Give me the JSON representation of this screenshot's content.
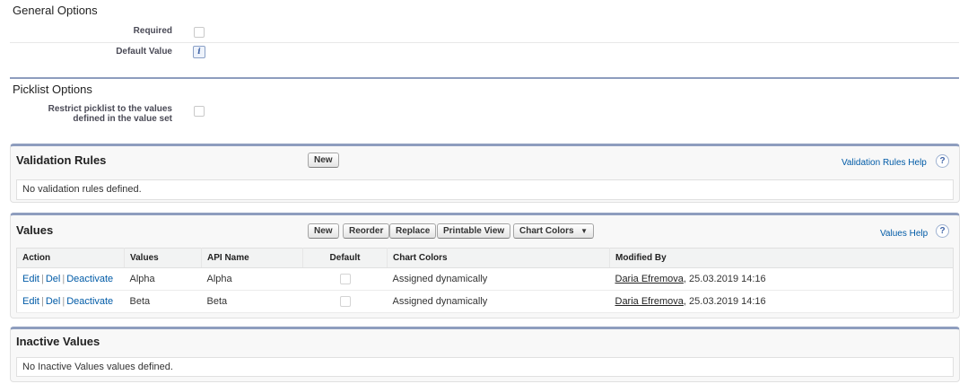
{
  "general": {
    "title": "General Options",
    "required_label": "Required",
    "default_value_label": "Default Value",
    "info_icon": "i"
  },
  "picklist": {
    "title": "Picklist Options",
    "restrict_label_line1": "Restrict picklist to the values",
    "restrict_label_line2": "defined in the value set"
  },
  "validation": {
    "title": "Validation Rules",
    "new_button": "New",
    "help_link": "Validation Rules Help",
    "help_icon": "?",
    "empty_message": "No validation rules defined."
  },
  "values": {
    "title": "Values",
    "buttons": {
      "new": "New",
      "reorder": "Reorder",
      "replace": "Replace",
      "printable": "Printable View",
      "chart_colors": "Chart Colors",
      "chart_colors_arrow": "▼"
    },
    "help_link": "Values Help",
    "help_icon": "?",
    "columns": [
      "Action",
      "Values",
      "API Name",
      "Default",
      "Chart Colors",
      "Modified By"
    ],
    "action_labels": {
      "edit": "Edit",
      "del": "Del",
      "deactivate": "Deactivate",
      "separator": "|"
    },
    "rows": [
      {
        "value": "Alpha",
        "api_name": "Alpha",
        "default": false,
        "chart_colors": "Assigned dynamically",
        "modified_user": "Daria Efremova",
        "modified_date": ", 25.03.2019 14:16"
      },
      {
        "value": "Beta",
        "api_name": "Beta",
        "default": false,
        "chart_colors": "Assigned dynamically",
        "modified_user": "Daria Efremova",
        "modified_date": ", 25.03.2019 14:16"
      }
    ]
  },
  "inactive": {
    "title": "Inactive Values",
    "empty_message": "No Inactive Values values defined."
  },
  "colors": {
    "accent_bar": "#8e9dbe",
    "link": "#015ba7"
  }
}
